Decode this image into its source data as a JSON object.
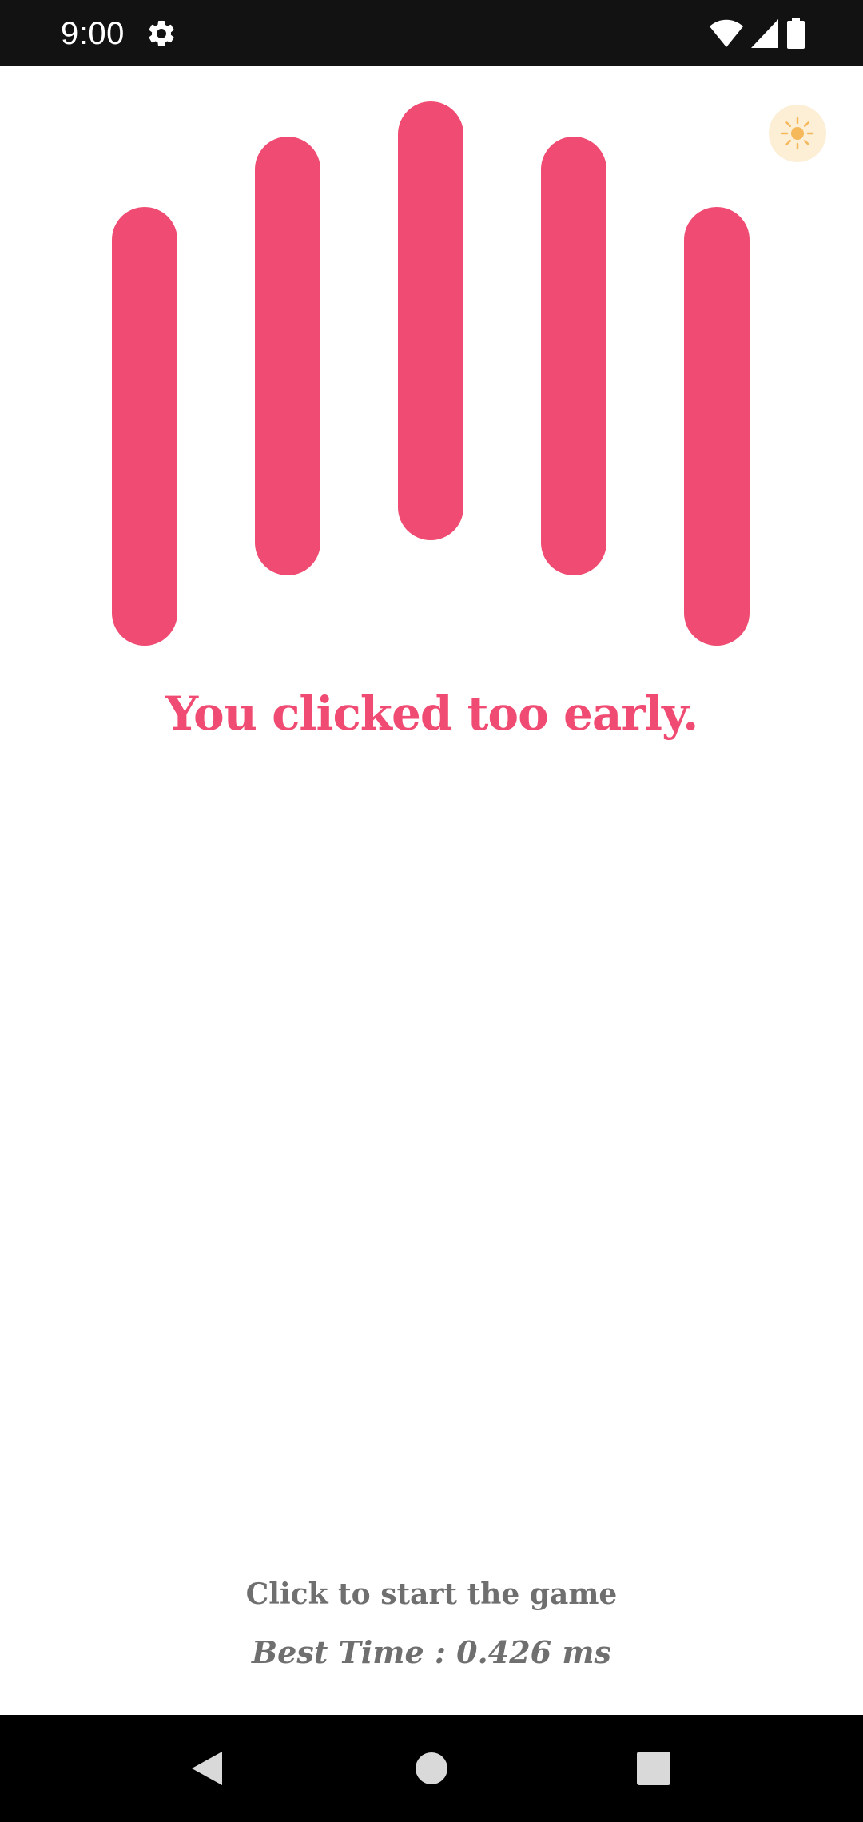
{
  "status_bar": {
    "time": "9:00",
    "icons": [
      "gear-icon",
      "wifi-icon",
      "cellular-signal-icon",
      "battery-icon"
    ]
  },
  "theme_toggle": {
    "icon": "sun-icon",
    "bg_color": "#fcefd6",
    "icon_color": "#f5b85a"
  },
  "bars": {
    "color": "#f04b72",
    "count": 5
  },
  "message": {
    "text": "You clicked too early.",
    "color": "#f04b72"
  },
  "footer": {
    "start_prompt": "Click to start the game",
    "best_time": "Best Time : 0.426 ms"
  },
  "nav_bar": {
    "icons": [
      "back-icon",
      "home-icon",
      "recents-icon"
    ]
  }
}
